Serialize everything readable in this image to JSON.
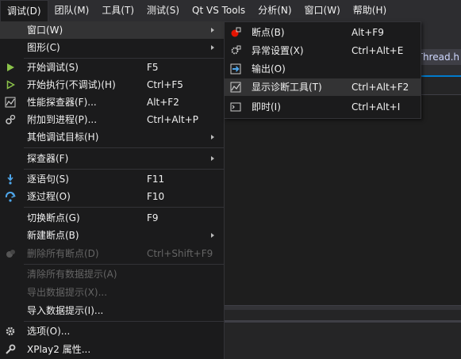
{
  "menubar": {
    "items": [
      "调试(D)",
      "团队(M)",
      "工具(T)",
      "测试(S)",
      "Qt VS Tools",
      "分析(N)",
      "窗口(W)",
      "帮助(H)"
    ]
  },
  "background": {
    "tab_label": "Thread.h"
  },
  "debug_menu": {
    "window": {
      "label": "窗口(W)"
    },
    "graphics": {
      "label": "图形(C)"
    },
    "start_debugging": {
      "label": "开始调试(S)",
      "shortcut": "F5"
    },
    "start_without_debugging": {
      "label": "开始执行(不调试)(H)",
      "shortcut": "Ctrl+F5"
    },
    "performance_profiler": {
      "label": "性能探查器(F)...",
      "shortcut": "Alt+F2"
    },
    "attach_to_process": {
      "label": "附加到进程(P)...",
      "shortcut": "Ctrl+Alt+P"
    },
    "other_debug_targets": {
      "label": "其他调试目标(H)"
    },
    "profiler": {
      "label": "探查器(F)"
    },
    "step_into": {
      "label": "逐语句(S)",
      "shortcut": "F11"
    },
    "step_over": {
      "label": "逐过程(O)",
      "shortcut": "F10"
    },
    "toggle_breakpoint": {
      "label": "切换断点(G)",
      "shortcut": "F9"
    },
    "new_breakpoint": {
      "label": "新建断点(B)"
    },
    "delete_all_breakpoints": {
      "label": "删除所有断点(D)",
      "shortcut": "Ctrl+Shift+F9"
    },
    "clear_all_datatips": {
      "label": "清除所有数据提示(A)"
    },
    "export_datatips": {
      "label": "导出数据提示(X)..."
    },
    "import_datatips": {
      "label": "导入数据提示(I)..."
    },
    "options": {
      "label": "选项(O)..."
    },
    "project_properties": {
      "label": "XPlay2 属性..."
    }
  },
  "window_submenu": {
    "breakpoints": {
      "label": "断点(B)",
      "shortcut": "Alt+F9"
    },
    "exception_settings": {
      "label": "异常设置(X)",
      "shortcut": "Ctrl+Alt+E"
    },
    "output": {
      "label": "输出(O)"
    },
    "diagnostic_tools": {
      "label": "显示诊断工具(T)",
      "shortcut": "Ctrl+Alt+F2"
    },
    "immediate": {
      "label": "即时(I)",
      "shortcut": "Ctrl+Alt+I"
    }
  },
  "colors": {
    "menu_bg": "#1b1b1c",
    "menubar_bg": "#2d2d30",
    "highlight": "#333334",
    "accent": "#007acc",
    "disabled_text": "#656565",
    "breakpoint_red": "#e51400",
    "run_green": "#8bc34a"
  }
}
